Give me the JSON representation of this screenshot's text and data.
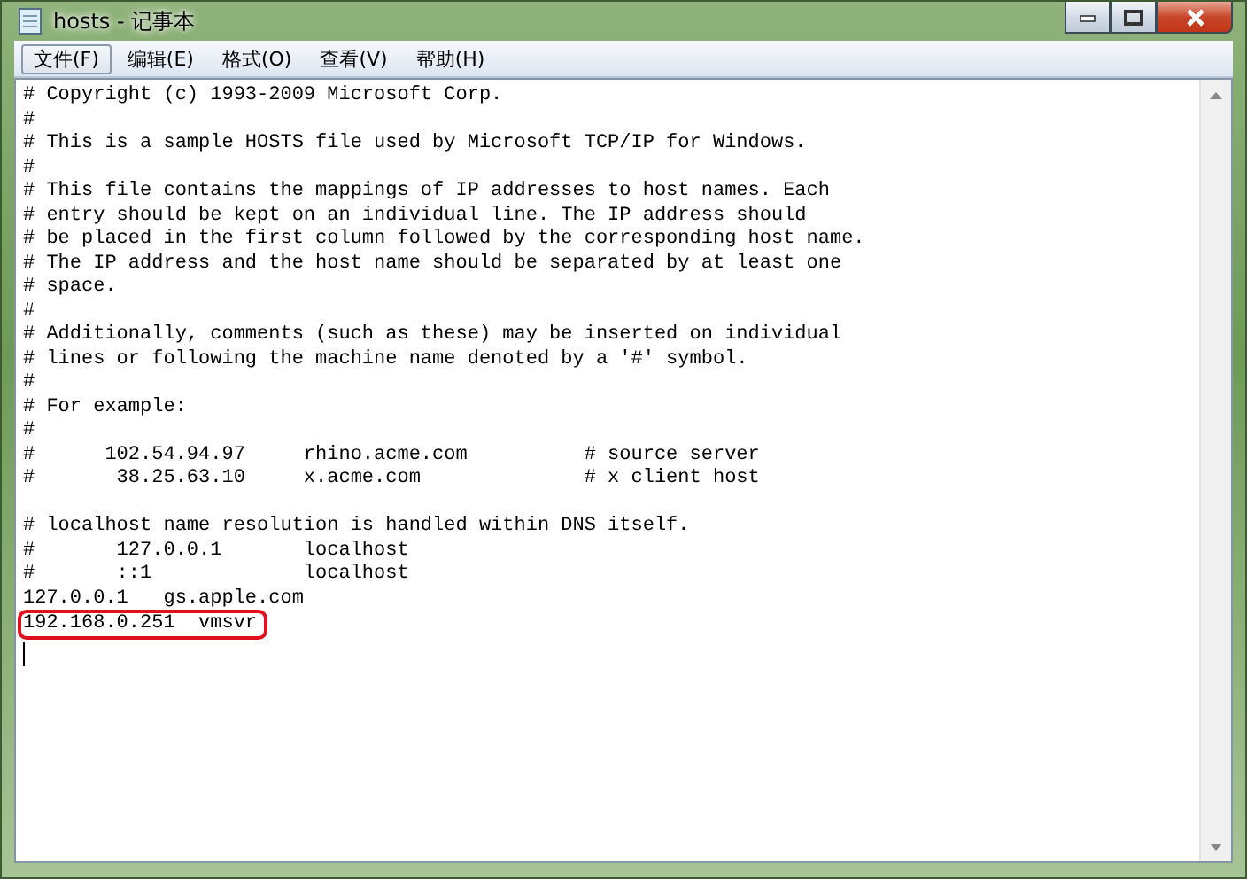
{
  "window": {
    "title": "hosts - 记事本"
  },
  "menu": [
    {
      "label": "文件(F)",
      "selected": true
    },
    {
      "label": "编辑(E)",
      "selected": false
    },
    {
      "label": "格式(O)",
      "selected": false
    },
    {
      "label": "查看(V)",
      "selected": false
    },
    {
      "label": "帮助(H)",
      "selected": false
    }
  ],
  "lines": [
    {
      "kind": "text",
      "text": "# Copyright (c) 1993-2009 Microsoft Corp."
    },
    {
      "kind": "text",
      "text": "#"
    },
    {
      "kind": "text",
      "text": "# This is a sample HOSTS file used by Microsoft TCP/IP for Windows."
    },
    {
      "kind": "text",
      "text": "#"
    },
    {
      "kind": "text",
      "text": "# This file contains the mappings of IP addresses to host names. Each"
    },
    {
      "kind": "text",
      "text": "# entry should be kept on an individual line. The IP address should"
    },
    {
      "kind": "text",
      "text": "# be placed in the first column followed by the corresponding host name."
    },
    {
      "kind": "text",
      "text": "# The IP address and the host name should be separated by at least one"
    },
    {
      "kind": "text",
      "text": "# space."
    },
    {
      "kind": "text",
      "text": "#"
    },
    {
      "kind": "text",
      "text": "# Additionally, comments (such as these) may be inserted on individual"
    },
    {
      "kind": "text",
      "text": "# lines or following the machine name denoted by a '#' symbol."
    },
    {
      "kind": "text",
      "text": "#"
    },
    {
      "kind": "text",
      "text": "# For example:"
    },
    {
      "kind": "text",
      "text": "#"
    },
    {
      "kind": "text",
      "text": "#      102.54.94.97     rhino.acme.com          # source server"
    },
    {
      "kind": "text",
      "text": "#       38.25.63.10     x.acme.com              # x client host"
    },
    {
      "kind": "blank"
    },
    {
      "kind": "text",
      "text": "# localhost name resolution is handled within DNS itself."
    },
    {
      "kind": "text",
      "text": "#       127.0.0.1       localhost"
    },
    {
      "kind": "text",
      "text": "#       ::1             localhost"
    },
    {
      "kind": "text",
      "text": "127.0.0.1   gs.apple.com"
    },
    {
      "kind": "marked",
      "text": "192.168.0.251  vmsvr"
    },
    {
      "kind": "caret"
    }
  ]
}
